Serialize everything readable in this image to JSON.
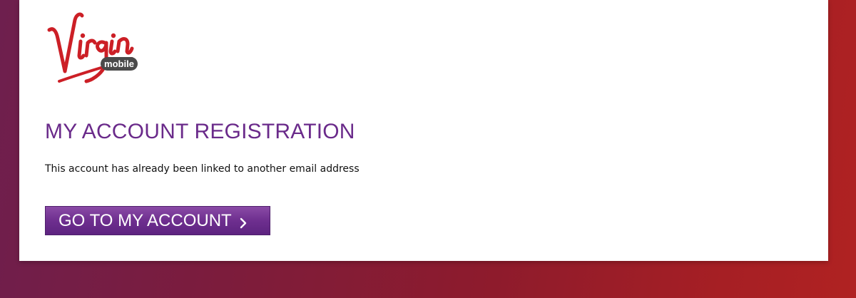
{
  "brand": {
    "logo_wordmark": "Virgin",
    "logo_badge": "mobile",
    "primary_color": "#6a2a8a",
    "logo_red": "#cc1f26"
  },
  "main": {
    "title": "MY ACCOUNT REGISTRATION",
    "message": "This account has already been linked to another email address",
    "cta_label": "GO TO MY ACCOUNT",
    "cta_icon": "chevron-right-icon"
  }
}
